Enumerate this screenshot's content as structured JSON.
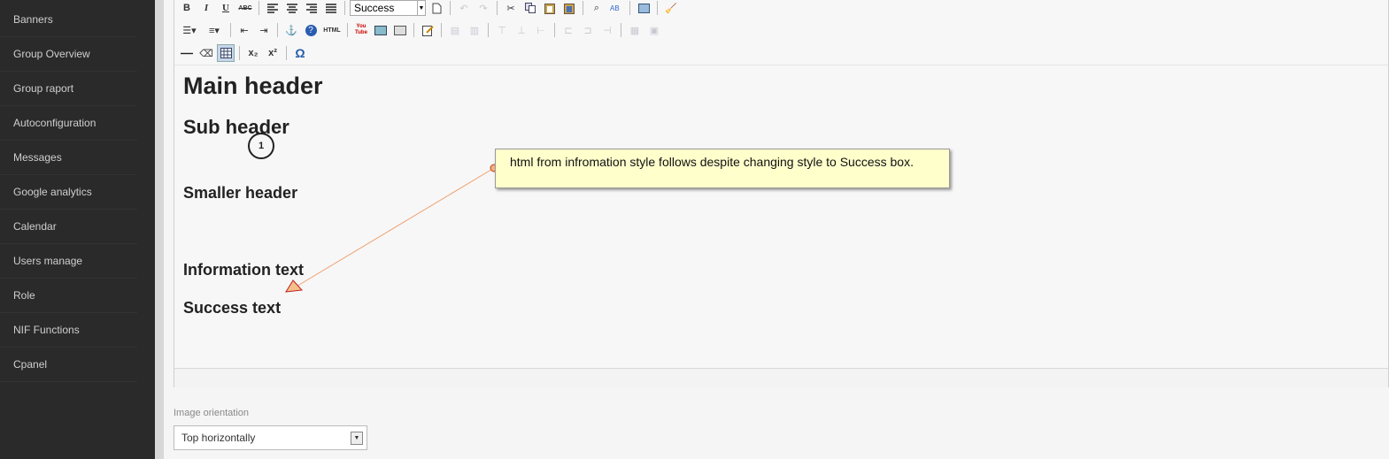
{
  "sidebar": {
    "items": [
      {
        "label": "Banners"
      },
      {
        "label": "Group Overview"
      },
      {
        "label": "Group raport"
      },
      {
        "label": "Autoconfiguration"
      },
      {
        "label": "Messages"
      },
      {
        "label": "Google analytics"
      },
      {
        "label": "Calendar"
      },
      {
        "label": "Users manage"
      },
      {
        "label": "Role"
      },
      {
        "label": "NIF Functions"
      },
      {
        "label": "Cpanel"
      }
    ]
  },
  "toolbar": {
    "bold": "B",
    "italic": "I",
    "underline": "U",
    "strike": "ABC",
    "style_value": "Success",
    "html_label": "HTML",
    "youtube_label": "You Tube",
    "subscript": "x₂",
    "superscript": "x²",
    "omega": "Ω"
  },
  "content": {
    "main_header": "Main header",
    "sub_header": "Sub header",
    "smaller_header": "Smaller header",
    "information_text": "Information text",
    "success_text": "Success text"
  },
  "form": {
    "image_orientation_label": "Image orientation",
    "image_orientation_value": "Top horizontally"
  },
  "annotation": {
    "marker_number": "1",
    "note_text": "html from infromation style follows despite changing style to Success box."
  }
}
